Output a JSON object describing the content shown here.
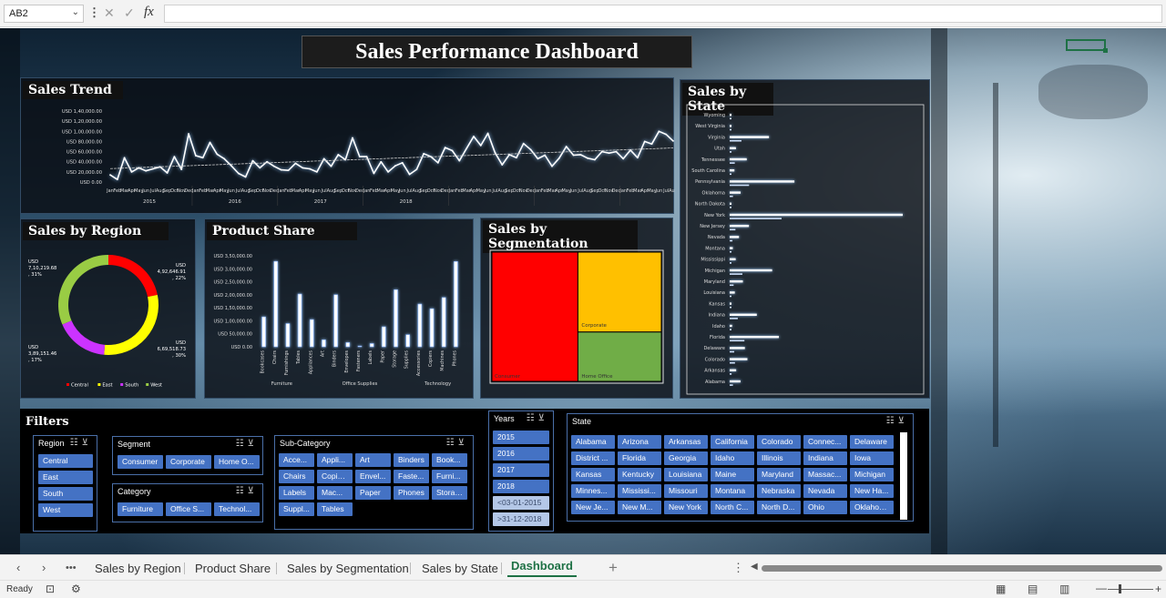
{
  "formula_bar": {
    "name_box": "AB2",
    "dropdown_icon": "chevron-down-icon",
    "more_icon": "vertical-dots-icon",
    "cancel_icon": "close-icon",
    "confirm_icon": "check-icon",
    "fx_label": "fx",
    "value": ""
  },
  "dashboard": {
    "title": "Sales Performance Dashboard",
    "panels": {
      "trend": "Sales Trend",
      "region": "Sales by Region",
      "product": "Product Share",
      "segmentation": "Sales by Segmentation",
      "state": "Sales by State"
    }
  },
  "chart_data": [
    {
      "id": "sales_trend",
      "type": "line",
      "title": "Sales Trend",
      "y_ticks": [
        "USD 1,40,000.00",
        "USD 1,20,000.00",
        "USD 1,00,000.00",
        "USD 80,000.00",
        "USD 60,000.00",
        "USD 40,000.00",
        "USD 20,000.00",
        "USD 0.00"
      ],
      "ylim": [
        0,
        140000
      ],
      "months": [
        "Jan",
        "Feb",
        "Mar",
        "Apr",
        "May",
        "Jun",
        "Jul",
        "Aug",
        "Sep",
        "Oct",
        "Nov",
        "Dec"
      ],
      "years": [
        "2015",
        "2016",
        "2017",
        "2018"
      ],
      "values": [
        14000,
        5000,
        48000,
        20000,
        28000,
        22000,
        26000,
        30000,
        18000,
        50000,
        25000,
        95000,
        52000,
        48000,
        78000,
        55000,
        46000,
        32000,
        17000,
        10000,
        42000,
        28000,
        40000,
        31000,
        24000,
        23000,
        37000,
        28000,
        26000,
        20000,
        46000,
        31000,
        54000,
        44000,
        87000,
        50000,
        50000,
        17000,
        40000,
        20000,
        32000,
        38000,
        15000,
        25000,
        56000,
        50000,
        38000,
        68000,
        62000,
        42000,
        66000,
        90000,
        72000,
        96000,
        58000,
        34000,
        54000,
        48000,
        76000,
        64000,
        46000,
        53000,
        31000,
        47000,
        70000,
        53000,
        54000,
        47000,
        44000,
        60000,
        57000,
        60000,
        46000,
        63000,
        48000,
        80000,
        75000,
        100000,
        94000,
        81000
      ],
      "trendline": true,
      "grid": false
    },
    {
      "id": "sales_by_region",
      "type": "pie",
      "title": "Sales by Region",
      "donut": true,
      "series": [
        {
          "name": "Central",
          "value": 492646.91,
          "label": "USD 4,92,646.91 , 22%",
          "color": "#ff0000"
        },
        {
          "name": "East",
          "value": 669518.73,
          "label": "USD 6,69,518.73 , 30%",
          "color": "#ffff00"
        },
        {
          "name": "South",
          "value": 389151.46,
          "label": "USD 3,89,151.46 , 17%",
          "color": "#cc33ff"
        },
        {
          "name": "West",
          "value": 710219.68,
          "label": "USD 7,10,219.68 , 31%",
          "color": "#99cc44"
        }
      ],
      "legend": "bottom"
    },
    {
      "id": "product_share",
      "type": "bar",
      "title": "Product Share",
      "y_ticks": [
        "USD 3,50,000.00",
        "USD 3,00,000.00",
        "USD 2,50,000.00",
        "USD 2,00,000.00",
        "USD 1,50,000.00",
        "USD 1,00,000.00",
        "USD 50,000.00",
        "USD 0.00"
      ],
      "ylim": [
        0,
        350000
      ],
      "categories": [
        "Bookcases",
        "Chairs",
        "Furnishings",
        "Tables",
        "Appliances",
        "Art",
        "Binders",
        "Envelopes",
        "Fasteners",
        "Labels",
        "Paper",
        "Storage",
        "Supplies",
        "Accessories",
        "Copiers",
        "Machines",
        "Phones"
      ],
      "groups": [
        {
          "name": "Furniture",
          "count": 4
        },
        {
          "name": "Office Supplies",
          "count": 9
        },
        {
          "name": "Technology",
          "count": 4
        }
      ],
      "values": [
        114880,
        328449,
        89212,
        202810,
        104618,
        26705,
        200029,
        16128,
        3001,
        12347,
        76828,
        219343,
        46420,
        164187,
        146248,
        189239,
        327782
      ]
    },
    {
      "id": "sales_by_segmentation",
      "type": "heatmap",
      "title": "Sales by Segmentation",
      "series": [
        {
          "name": "Consumer",
          "value": 1148061,
          "color": "#ff0000"
        },
        {
          "name": "Corporate",
          "value": 688494,
          "color": "#ffc000"
        },
        {
          "name": "Home Office",
          "value": 424982,
          "color": "#70ad47"
        }
      ]
    },
    {
      "id": "sales_by_state",
      "type": "bar",
      "orientation": "horizontal",
      "title": "Sales by State",
      "categories": [
        "Wyoming",
        "West Virginia",
        "Virginia",
        "Utah",
        "Tennessee",
        "South Carolina",
        "Pennsylvania",
        "Oklahoma",
        "North Dakota",
        "New York",
        "New Jersey",
        "Nevada",
        "Montana",
        "Mississippi",
        "Michigan",
        "Maryland",
        "Louisiana",
        "Kansas",
        "Indiana",
        "Idaho",
        "Florida",
        "Delaware",
        "Colorado",
        "Arkansas",
        "Alabama"
      ],
      "values": [
        1603,
        1209,
        70637,
        11220,
        30662,
        8481,
        116276,
        19683,
        920,
        310876,
        34611,
        16729,
        5589,
        10771,
        76270,
        23705,
        9217,
        2914,
        48719,
        4382,
        88436,
        27322,
        31841,
        11678,
        19511
      ]
    }
  ],
  "filters": {
    "title": "Filters",
    "region": {
      "header": "Region",
      "items": [
        "Central",
        "East",
        "South",
        "West"
      ]
    },
    "segment": {
      "header": "Segment",
      "items": [
        "Consumer",
        "Corporate",
        "Home O..."
      ]
    },
    "category": {
      "header": "Category",
      "items": [
        "Furniture",
        "Office S...",
        "Technol..."
      ]
    },
    "subcategory": {
      "header": "Sub-Category",
      "items": [
        "Acce...",
        "Appli...",
        "Art",
        "Binders",
        "Book...",
        "Chairs",
        "Copiers",
        "Envel...",
        "Faste...",
        "Furni...",
        "Labels",
        "Mac...",
        "Paper",
        "Phones",
        "Storage",
        "Suppl...",
        "Tables"
      ]
    },
    "years": {
      "header": "Years",
      "items": [
        "2015",
        "2016",
        "2017",
        "2018"
      ],
      "dim_items": [
        "<03-01-2015",
        ">31-12-2018"
      ]
    },
    "state": {
      "header": "State",
      "items": [
        "Alabama",
        "Arizona",
        "Arkansas",
        "California",
        "Colorado",
        "Connec...",
        "Delaware",
        "District ...",
        "Florida",
        "Georgia",
        "Idaho",
        "Illinois",
        "Indiana",
        "Iowa",
        "Kansas",
        "Kentucky",
        "Louisiana",
        "Maine",
        "Maryland",
        "Massac...",
        "Michigan",
        "Minnes...",
        "Mississi...",
        "Missouri",
        "Montana",
        "Nebraska",
        "Nevada",
        "New Ha...",
        "New Je...",
        "New M...",
        "New York",
        "North C...",
        "North D...",
        "Ohio",
        "Oklahoma"
      ]
    },
    "multiselect_icon": "multi-select-icon",
    "clear_icon": "clear-filter-icon"
  },
  "tabs": {
    "prev_icon": "chevron-left-icon",
    "next_icon": "chevron-right-icon",
    "more": "•••",
    "items": [
      "Sales by Region",
      "Product Share",
      "Sales by Segmentation",
      "Sales by State",
      "Dashboard"
    ],
    "active": "Dashboard",
    "add": "+",
    "options_icon": "vertical-dots-icon",
    "scroll_left_icon": "triangle-left-icon"
  },
  "status_bar": {
    "ready": "Ready",
    "icons": [
      "macro-record-icon",
      "accessibility-icon",
      "normal-view-icon",
      "page-layout-icon",
      "page-break-icon"
    ],
    "zoom_minus": "—",
    "zoom_plus": "+"
  }
}
